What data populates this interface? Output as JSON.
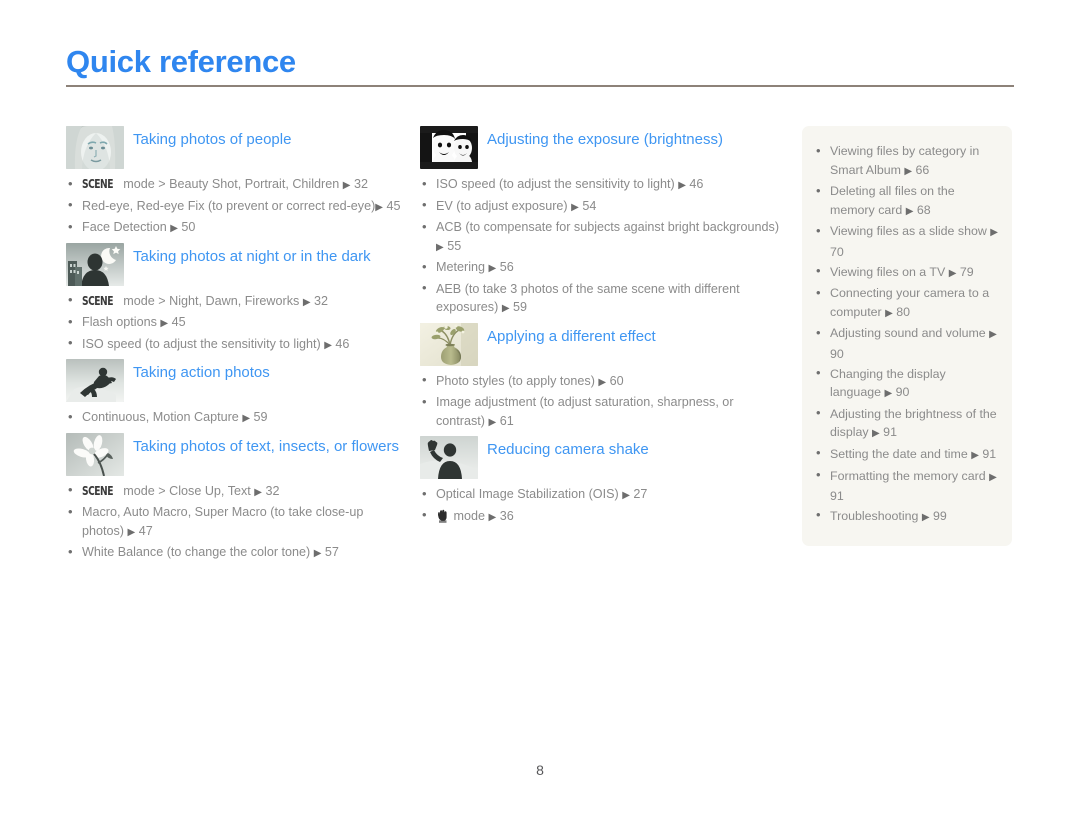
{
  "header": {
    "title": "Quick reference",
    "rule_color": "#8d8279",
    "title_color": "#2f86ef"
  },
  "footer": {
    "page_number": "8"
  },
  "colors": {
    "heading_blue": "#3f96f2",
    "body_gray": "#8b8b8b",
    "panel_bg": "#f7f6f1"
  },
  "columns": [
    {
      "name": "column-one",
      "sections": [
        {
          "icon": "portrait-face-photo-icon",
          "title": "Taking photos of people",
          "items": [
            {
              "scene": "SCENE",
              "text": " mode > Beauty Shot, Portrait, Children ",
              "arrow": "▶",
              "page": "32"
            },
            {
              "text": "Red-eye, Red-eye Fix (to prevent or correct red-eye)",
              "arrow": "▶",
              "page": "45",
              "wrap": true
            },
            {
              "text": "Face Detection ",
              "arrow": "▶",
              "page": "50"
            }
          ]
        },
        {
          "icon": "night-scene-photo-icon",
          "title": "Taking photos at night or in the dark",
          "items": [
            {
              "scene": "SCENE",
              "text": " mode > Night, Dawn, Fireworks ",
              "arrow": "▶",
              "page": "32"
            },
            {
              "text": "Flash options ",
              "arrow": "▶",
              "page": "45"
            },
            {
              "text": "ISO speed (to adjust the sensitivity to light) ",
              "arrow": "▶",
              "page": "46"
            }
          ]
        },
        {
          "icon": "snowboarder-action-photo-icon",
          "title": "Taking action photos",
          "items": [
            {
              "text": "Continuous, Motion Capture ",
              "arrow": "▶",
              "page": "59"
            }
          ]
        },
        {
          "icon": "flower-macro-photo-icon",
          "title": "Taking photos of text, insects, or flowers",
          "items": [
            {
              "scene": "SCENE",
              "text": " mode > Close Up, Text ",
              "arrow": "▶",
              "page": "32"
            },
            {
              "text": "Macro, Auto Macro, Super Macro (to take close-up photos) ",
              "arrow": "▶",
              "page": "47"
            },
            {
              "text": "White Balance (to change the color tone) ",
              "arrow": "▶",
              "page": "57"
            }
          ]
        }
      ]
    },
    {
      "name": "column-two",
      "sections": [
        {
          "icon": "two-faces-exposure-photo-icon",
          "title": "Adjusting the exposure (brightness)",
          "items": [
            {
              "text": "ISO speed (to adjust the sensitivity to light) ",
              "arrow": "▶",
              "page": "46"
            },
            {
              "text": "EV (to adjust exposure) ",
              "arrow": "▶",
              "page": "54"
            },
            {
              "text": "ACB (to compensate for subjects against bright backgrounds) ",
              "arrow": "▶",
              "page": "55"
            },
            {
              "text": "Metering ",
              "arrow": "▶",
              "page": "56"
            },
            {
              "text": "AEB (to take 3 photos of the same scene with different exposures) ",
              "arrow": "▶",
              "page": "59"
            }
          ]
        },
        {
          "icon": "vase-flowers-effect-photo-icon",
          "title": "Applying a different effect",
          "items": [
            {
              "text": "Photo styles (to apply tones) ",
              "arrow": "▶",
              "page": "60"
            },
            {
              "text": "Image adjustment (to adjust saturation, sharpness, or contrast) ",
              "arrow": "▶",
              "page": "61"
            }
          ]
        },
        {
          "icon": "waving-person-shake-photo-icon",
          "title": "Reducing camera shake",
          "items": [
            {
              "text": "Optical Image Stabilization (OIS) ",
              "arrow": "▶",
              "page": "27"
            },
            {
              "hand_icon": "hand-shake-mode-icon",
              "text": " mode ",
              "arrow": "▶",
              "page": "36"
            }
          ]
        }
      ]
    }
  ],
  "sidebar": {
    "name": "playback-settings-panel",
    "items": [
      {
        "text": "Viewing files by category in Smart Album ",
        "arrow": "▶",
        "page": "66"
      },
      {
        "text": "Deleting all files on the memory card ",
        "arrow": "▶",
        "page": "68"
      },
      {
        "text": "Viewing files as a slide show ",
        "arrow": "▶",
        "page": "70"
      },
      {
        "text": "Viewing files on a TV ",
        "arrow": "▶",
        "page": "79"
      },
      {
        "text": "Connecting your camera to a computer ",
        "arrow": "▶",
        "page": "80"
      },
      {
        "text": "Adjusting sound and volume ",
        "arrow": "▶",
        "page": "90"
      },
      {
        "text": "Changing the display language ",
        "arrow": "▶",
        "page": "90"
      },
      {
        "text": "Adjusting the brightness of the display ",
        "arrow": "▶",
        "page": "91"
      },
      {
        "text": "Setting the date and time ",
        "arrow": "▶",
        "page": "91"
      },
      {
        "text": "Formatting the memory card ",
        "arrow": "▶",
        "page": "91"
      },
      {
        "text": "Troubleshooting ",
        "arrow": "▶",
        "page": "99"
      }
    ]
  }
}
